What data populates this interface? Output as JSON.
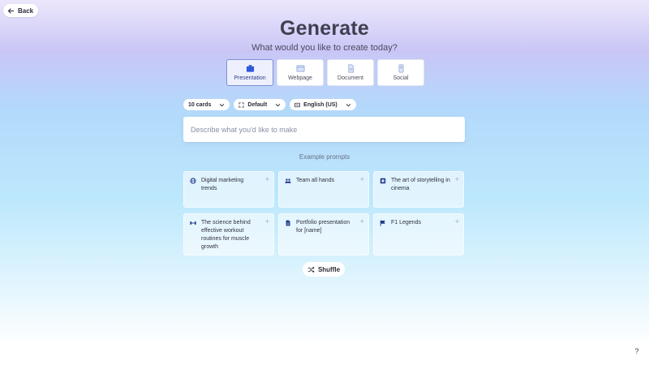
{
  "nav": {
    "back_label": "Back"
  },
  "header": {
    "title": "Generate",
    "subtitle": "What would you like to create today?"
  },
  "types": [
    {
      "label": "Presentation",
      "icon": "presentation-icon",
      "selected": true
    },
    {
      "label": "Webpage",
      "icon": "webpage-icon",
      "selected": false
    },
    {
      "label": "Document",
      "icon": "document-icon",
      "selected": false
    },
    {
      "label": "Social",
      "icon": "social-icon",
      "selected": false
    }
  ],
  "controls": {
    "cards": "10 cards",
    "theme": "Default",
    "language": "English (US)"
  },
  "prompt": {
    "placeholder": "Describe what you'd like to make"
  },
  "examples": {
    "label": "Example prompts",
    "items": [
      {
        "text": "Digital marketing trends",
        "icon": "globe-icon"
      },
      {
        "text": "Team all hands",
        "icon": "people-icon"
      },
      {
        "text": "The art of storytelling in cinema",
        "icon": "film-icon"
      },
      {
        "text": "The science behind effective workout routines for muscle growth",
        "icon": "dumbbell-icon"
      },
      {
        "text": "Portfolio presentation for [name]",
        "icon": "document-icon"
      },
      {
        "text": "F1 Legends",
        "icon": "flag-icon"
      }
    ],
    "plus_symbol": "+"
  },
  "shuffle_label": "Shuffle",
  "help_label": "?",
  "colors": {
    "accent": "#7f8fd6",
    "icon_blue": "#1e3a8a",
    "selected_bg": "#eef1fd"
  }
}
